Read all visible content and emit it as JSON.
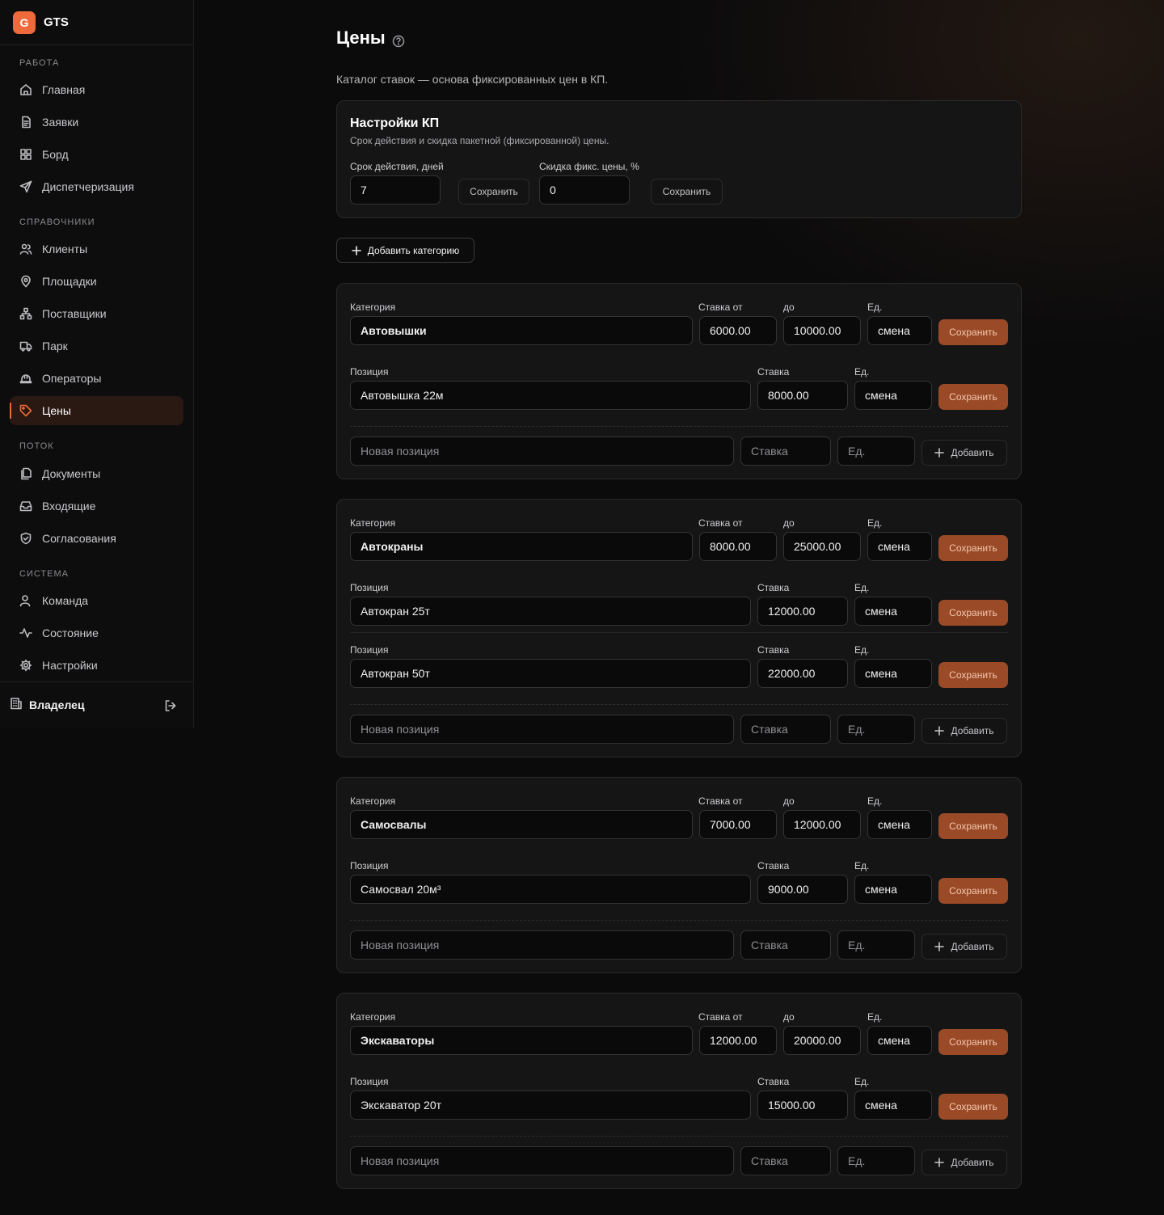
{
  "app": {
    "logo_letter": "G",
    "name": "GTS"
  },
  "sidebar": {
    "sections": [
      {
        "label": "РАБОТА"
      },
      {
        "label": "СПРАВОЧНИКИ"
      },
      {
        "label": "ПОТОК"
      },
      {
        "label": "СИСТЕМА"
      }
    ],
    "items": [
      {
        "label": "Главная",
        "icon": "home-icon"
      },
      {
        "label": "Заявки",
        "icon": "file-icon"
      },
      {
        "label": "Борд",
        "icon": "grid-icon"
      },
      {
        "label": "Диспетчеризация",
        "icon": "send-icon"
      },
      {
        "label": "Клиенты",
        "icon": "users-icon"
      },
      {
        "label": "Площадки",
        "icon": "map-pin-icon"
      },
      {
        "label": "Поставщики",
        "icon": "network-icon"
      },
      {
        "label": "Парк",
        "icon": "truck-icon"
      },
      {
        "label": "Операторы",
        "icon": "hard-hat-icon"
      },
      {
        "label": "Цены",
        "icon": "tag-icon",
        "active": true
      },
      {
        "label": "Документы",
        "icon": "documents-icon"
      },
      {
        "label": "Входящие",
        "icon": "inbox-icon"
      },
      {
        "label": "Согласования",
        "icon": "shield-check-icon"
      },
      {
        "label": "Команда",
        "icon": "user-icon"
      },
      {
        "label": "Состояние",
        "icon": "activity-icon"
      },
      {
        "label": "Настройки",
        "icon": "gear-icon"
      }
    ],
    "footer": {
      "user": "Владелец",
      "icon": "building-icon",
      "logout_icon": "logout-icon"
    }
  },
  "page": {
    "title": "Цены",
    "subtitle": "Каталог ставок — основа фиксированных цен в КП."
  },
  "settings": {
    "title": "Настройки КП",
    "subtitle": "Срок действия и скидка пакетной (фиксированной) цены.",
    "validity_label": "Срок действия, дней",
    "validity_value": "7",
    "discount_label": "Скидка фикс. цены, %",
    "discount_value": "0",
    "save_label": "Сохранить"
  },
  "add_category_label": "Добавить категорию",
  "labels": {
    "category": "Категория",
    "rate_from": "Ставка от",
    "rate_to": "до",
    "unit": "Ед.",
    "position": "Позиция",
    "rate": "Ставка",
    "save": "Сохранить",
    "add": "Добавить",
    "new_position_placeholder": "Новая позиция",
    "rate_placeholder": "Ставка",
    "unit_placeholder": "Ед."
  },
  "categories": [
    {
      "name": "Автовышки",
      "rate_from": "6000.00",
      "rate_to": "10000.00",
      "unit": "смена",
      "positions": [
        {
          "name": "Автовышка 22м",
          "rate": "8000.00",
          "unit": "смена"
        }
      ]
    },
    {
      "name": "Автокраны",
      "rate_from": "8000.00",
      "rate_to": "25000.00",
      "unit": "смена",
      "positions": [
        {
          "name": "Автокран 25т",
          "rate": "12000.00",
          "unit": "смена"
        },
        {
          "name": "Автокран 50т",
          "rate": "22000.00",
          "unit": "смена"
        }
      ]
    },
    {
      "name": "Самосвалы",
      "rate_from": "7000.00",
      "rate_to": "12000.00",
      "unit": "смена",
      "positions": [
        {
          "name": "Самосвал 20м³",
          "rate": "9000.00",
          "unit": "смена"
        }
      ]
    },
    {
      "name": "Экскаваторы",
      "rate_from": "12000.00",
      "rate_to": "20000.00",
      "unit": "смена",
      "positions": [
        {
          "name": "Экскаватор 20т",
          "rate": "15000.00",
          "unit": "смена"
        }
      ]
    }
  ],
  "colors": {
    "accent": "#ef6a3a",
    "save_button": "#9a4a26",
    "background": "#0b0b0c",
    "card": "#151516"
  }
}
